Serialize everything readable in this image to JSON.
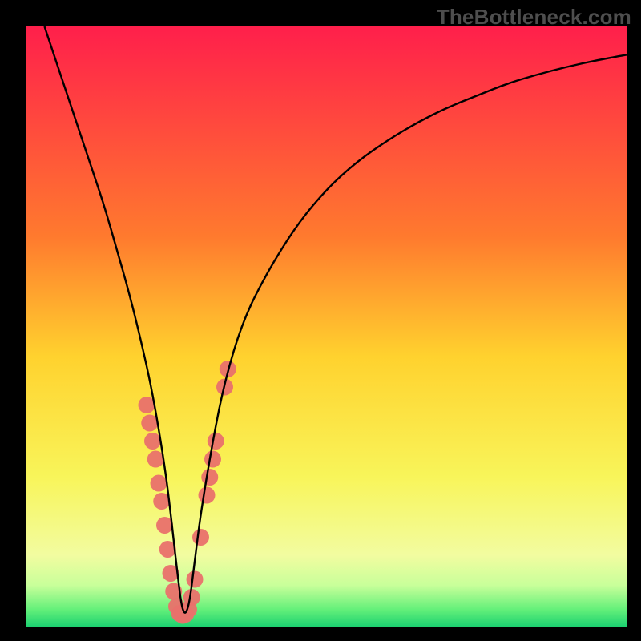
{
  "watermark": "TheBottleneck.com",
  "chart_data": {
    "type": "line",
    "title": "",
    "xlabel": "",
    "ylabel": "",
    "xlim": [
      0,
      100
    ],
    "ylim": [
      0,
      100
    ],
    "minimum_x": 26,
    "gradient_stops": [
      {
        "offset": 0,
        "color": "#ff1f4b"
      },
      {
        "offset": 35,
        "color": "#ff7a2e"
      },
      {
        "offset": 55,
        "color": "#ffd22e"
      },
      {
        "offset": 75,
        "color": "#f8f55a"
      },
      {
        "offset": 88,
        "color": "#f2fca0"
      },
      {
        "offset": 93,
        "color": "#c8ff9a"
      },
      {
        "offset": 97,
        "color": "#64f07a"
      },
      {
        "offset": 100,
        "color": "#19d070"
      }
    ],
    "curve": {
      "x": [
        3,
        5,
        7,
        9,
        11,
        13,
        15,
        17,
        19,
        21,
        23,
        24,
        25,
        26,
        27,
        28,
        29,
        31,
        33,
        36,
        40,
        45,
        50,
        55,
        60,
        65,
        70,
        75,
        80,
        85,
        90,
        95,
        100
      ],
      "y": [
        100,
        94,
        88,
        82,
        76,
        70,
        63,
        56,
        48,
        39,
        27,
        19,
        10,
        2,
        3,
        11,
        19,
        31,
        41,
        51,
        59,
        67,
        73,
        77.5,
        81,
        84,
        86.5,
        88.5,
        90.5,
        92,
        93.3,
        94.4,
        95.3
      ]
    },
    "scatter": {
      "x": [
        20,
        20.5,
        21,
        21.5,
        22,
        22.5,
        23,
        23.5,
        24,
        24.5,
        25,
        25.5,
        26,
        26.5,
        27,
        27.5,
        28,
        29,
        30,
        30.5,
        31,
        31.5,
        33,
        33.5
      ],
      "y": [
        37,
        34,
        31,
        28,
        24,
        21,
        17,
        13,
        9,
        6,
        3.5,
        2.3,
        2,
        2.2,
        3,
        5,
        8,
        15,
        22,
        25,
        28,
        31,
        40,
        43
      ]
    }
  }
}
